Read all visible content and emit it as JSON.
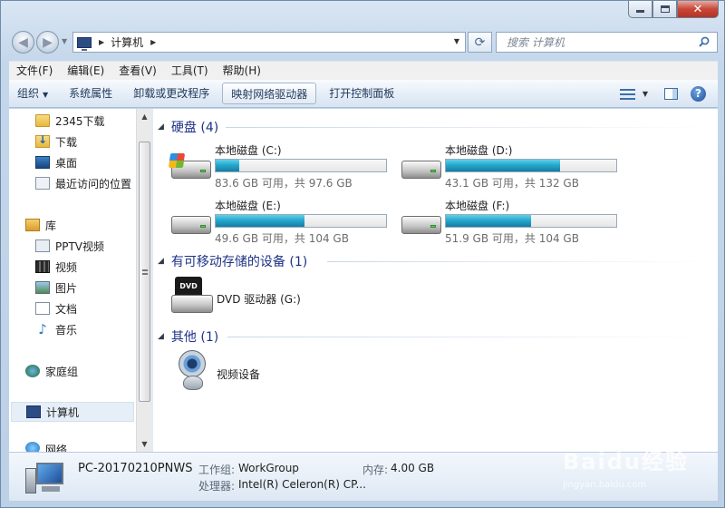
{
  "window": {
    "close_glyph": "✕"
  },
  "nav": {
    "address_segments": [
      "计算机"
    ],
    "search_placeholder": "搜索 计算机"
  },
  "menubar": [
    "文件(F)",
    "编辑(E)",
    "查看(V)",
    "工具(T)",
    "帮助(H)"
  ],
  "commands": {
    "organize": "组织",
    "system_properties": "系统属性",
    "uninstall": "卸载或更改程序",
    "map_drive": "映射网络驱动器",
    "control_panel": "打开控制面板"
  },
  "sidebar": {
    "items": [
      {
        "label": "2345下载",
        "icon": "folder-icon"
      },
      {
        "label": "下载",
        "icon": "downloads-icon"
      },
      {
        "label": "桌面",
        "icon": "desktop-icon"
      },
      {
        "label": "最近访问的位置",
        "icon": "recent-places-icon"
      },
      {
        "label": "库",
        "icon": "libraries-icon"
      },
      {
        "label": "PPTV视频",
        "icon": "pptv-video-icon"
      },
      {
        "label": "视频",
        "icon": "videos-icon"
      },
      {
        "label": "图片",
        "icon": "pictures-icon"
      },
      {
        "label": "文档",
        "icon": "documents-icon"
      },
      {
        "label": "音乐",
        "icon": "music-icon"
      },
      {
        "label": "家庭组",
        "icon": "homegroup-icon"
      },
      {
        "label": "计算机",
        "icon": "computer-icon"
      },
      {
        "label": "网络",
        "icon": "network-icon"
      }
    ]
  },
  "groups": {
    "hard_disks": "硬盘 (4)",
    "removable": "有可移动存储的设备 (1)",
    "other": "其他 (1)"
  },
  "drives": [
    {
      "name": "本地磁盘 (C:)",
      "info": "83.6 GB 可用，共 97.6 GB",
      "used_fraction": 0.14
    },
    {
      "name": "本地磁盘 (D:)",
      "info": "43.1 GB 可用，共 132 GB",
      "used_fraction": 0.67
    },
    {
      "name": "本地磁盘 (E:)",
      "info": "49.6 GB 可用，共 104 GB",
      "used_fraction": 0.52
    },
    {
      "name": "本地磁盘 (F:)",
      "info": "51.9 GB 可用，共 104 GB",
      "used_fraction": 0.5
    }
  ],
  "dvd": {
    "label": "DVD 驱动器 (G:)",
    "disc_text": "DVD"
  },
  "camera": {
    "label": "视频设备"
  },
  "details": {
    "computer_name": "PC-20170210PNWS",
    "workgroup_label": "工作组:",
    "workgroup_value": "WorkGroup",
    "memory_label": "内存:",
    "memory_value": "4.00 GB",
    "processor_label": "处理器:",
    "processor_value": "Intel(R) Celeron(R) CP..."
  },
  "watermark": {
    "main": "Baidu经验",
    "sub": "jingyan.baidu.com"
  },
  "colors": {
    "accent": "#1e3287",
    "drive_fill": "#27a7cd"
  }
}
